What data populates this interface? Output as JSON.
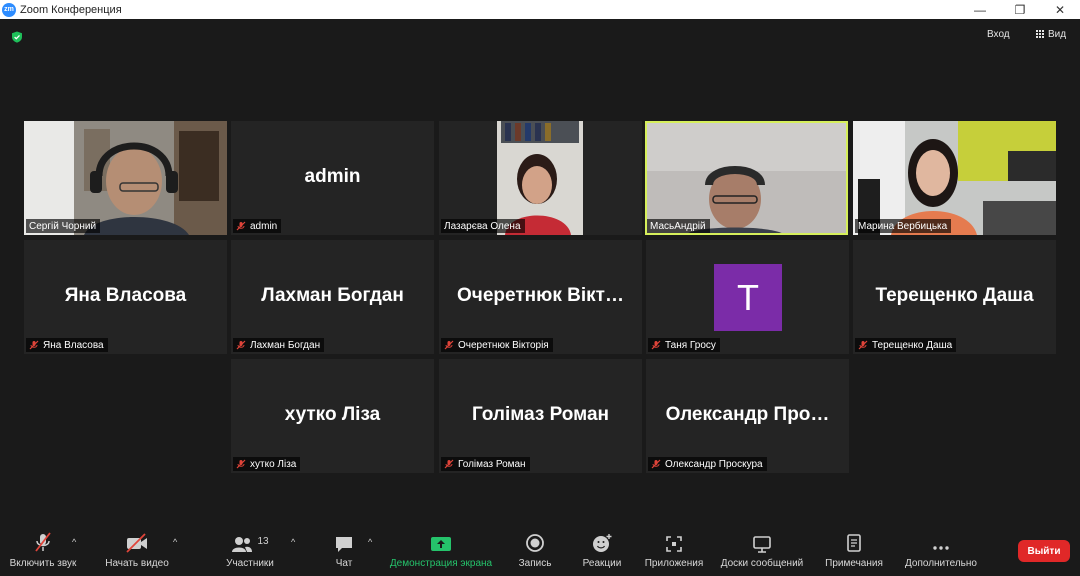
{
  "window": {
    "app_title": "Zoom Конференция",
    "logo_text": "zm",
    "minimize": "—",
    "maximize": "❐",
    "close": "✕"
  },
  "topbar": {
    "enter_label": "Вход",
    "view_label": "Вид"
  },
  "tiles": [
    {
      "type": "video",
      "name": "Сергій Чорний",
      "muted": false
    },
    {
      "type": "name",
      "display": "admin",
      "name": "admin",
      "muted": true
    },
    {
      "type": "video",
      "name": "Лазарєва Олена",
      "muted": false
    },
    {
      "type": "video",
      "name": "МасьАндрій",
      "muted": false,
      "active_speaker": true
    },
    {
      "type": "video",
      "name": "Марина Вербицька",
      "muted": false
    },
    {
      "type": "name",
      "display": "Яна Власова",
      "name": "Яна Власова",
      "muted": true
    },
    {
      "type": "name",
      "display": "Лахман Богдан",
      "name": "Лахман Богдан",
      "muted": true
    },
    {
      "type": "name",
      "display": "Очеретнюк  Вікт…",
      "name": "Очеретнюк Вікторія",
      "muted": true
    },
    {
      "type": "avatar",
      "avatar_letter": "T",
      "name": "Таня Гросу",
      "muted": true
    },
    {
      "type": "name",
      "display": "Терещенко Даша",
      "name": "Терещенко Даша",
      "muted": true
    },
    {
      "type": "name",
      "display": "хутко Ліза",
      "name": "хутко Ліза",
      "muted": true
    },
    {
      "type": "name",
      "display": "Голімаз Роман",
      "name": "Голімаз Роман",
      "muted": true
    },
    {
      "type": "name",
      "display": "Олександр  Про…",
      "name": "Олександр Проскура",
      "muted": true
    }
  ],
  "toolbar": {
    "audio_label": "Включить звук",
    "video_label": "Начать видео",
    "participants_label": "Участники",
    "participants_count": "13",
    "chat_label": "Чат",
    "share_label": "Демонстрация экрана",
    "record_label": "Запись",
    "reactions_label": "Реакции",
    "apps_label": "Приложения",
    "whiteboard_label": "Доски сообщений",
    "notes_label": "Примечания",
    "more_label": "Дополнительно",
    "leave_label": "Выйти",
    "caret": "^"
  },
  "colors": {
    "accent_green": "#25c36b",
    "active_border": "#d6ef5b",
    "leave_red": "#e02828",
    "avatar_purple": "#7b2ca8"
  }
}
